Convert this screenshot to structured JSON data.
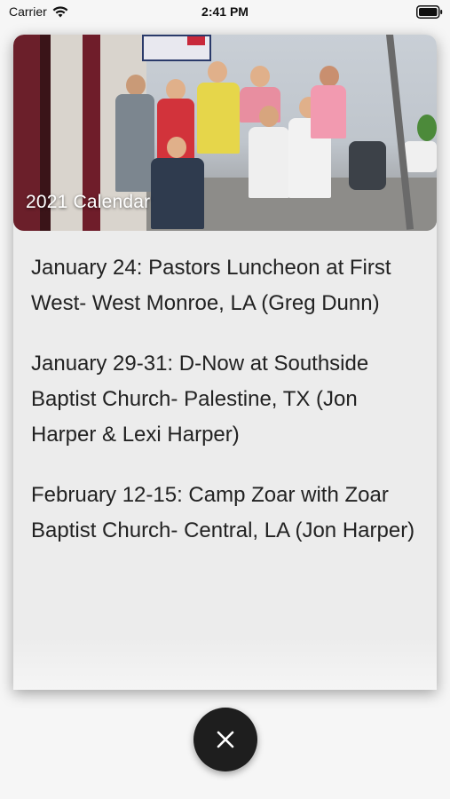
{
  "status_bar": {
    "carrier": "Carrier",
    "time": "2:41 PM",
    "icons": [
      "wifi-icon",
      "battery-icon"
    ]
  },
  "header": {
    "caption": "2021 Calendar",
    "image": "group-photo"
  },
  "events": [
    "January 24: Pastors Luncheon at First West- West Monroe, LA (Greg Dunn)",
    "January 29-31: D-Now at Southside Baptist Church- Palestine, TX (Jon Harper & Lexi Harper)",
    "February 12-15: Camp Zoar with Zoar Baptist Church- Central, LA (Jon Harper)"
  ],
  "close_button": {
    "icon": "close-icon",
    "color": "#1e1e1e"
  },
  "colors": {
    "background": "#f6f6f6",
    "card": "#ececec",
    "text": "#222222"
  }
}
